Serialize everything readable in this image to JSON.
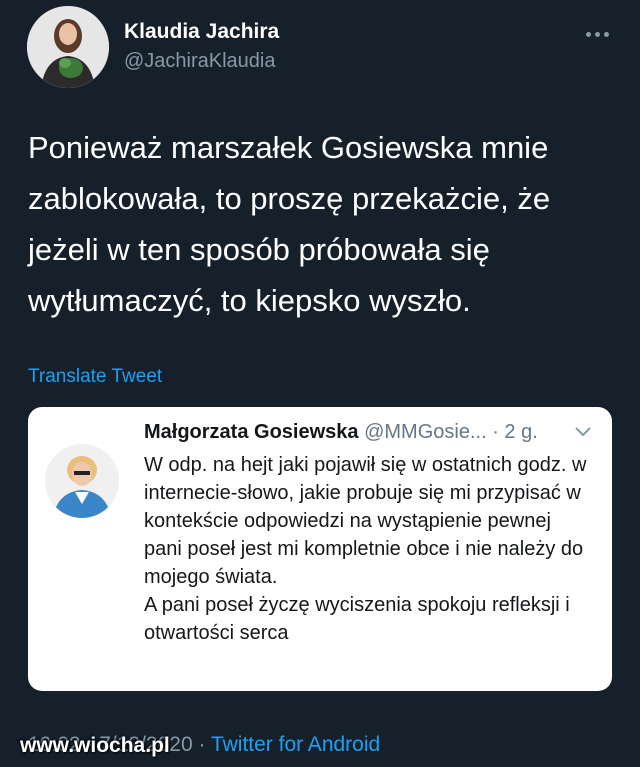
{
  "tweet": {
    "author_name": "Klaudia Jachira",
    "author_handle": "@JachiraKlaudia",
    "more_icon": "more-horizontal-icon",
    "text": "Ponieważ marszałek Gosiewska mnie zablokowała, to proszę przekażcie, że jeżeli w ten sposób próbowała się wytłumaczyć, to kiepsko wyszło.",
    "translate_label": "Translate Tweet",
    "timestamp": "10:02 · 7/12/2020",
    "separator": "·",
    "source": "Twitter for Android"
  },
  "quote": {
    "author_name": "Małgorzata Gosiewska",
    "author_handle": "@MMGosie...",
    "time_ago": "· 2 g.",
    "chevron_icon": "chevron-down-icon",
    "paragraph1": "W odp. na hejt jaki pojawił się w ostatnich godz. w internecie-słowo, jakie probuje się mi przypisać w kontekście odpowiedzi na wystąpienie pewnej pani poseł jest mi kompletnie obce i nie należy do mojego świata.",
    "paragraph2": "A pani poseł życzę wyciszenia spokoju refleksji i otwartości serca"
  },
  "watermark": "www.wiocha.pl",
  "colors": {
    "background": "#15202b",
    "primary_text": "#ffffff",
    "secondary_text": "#8899a6",
    "link": "#1da1f2",
    "card": "#ffffff"
  }
}
